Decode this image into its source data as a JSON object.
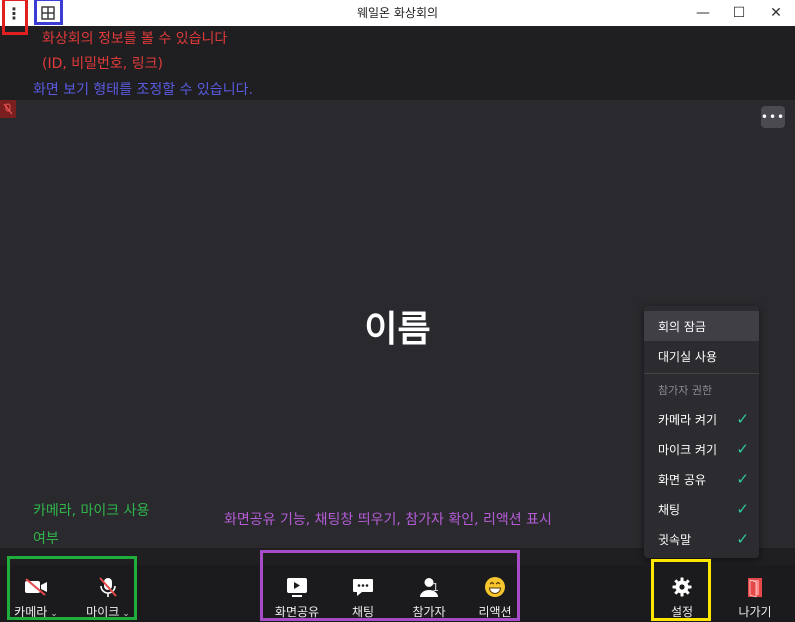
{
  "window": {
    "title": "웨일온 화상회의",
    "controls": {
      "minimize": "—",
      "maximize": "☐",
      "close": "✕"
    }
  },
  "annotations": {
    "info_line1": "화상회의 정보를 볼 수 있습니다",
    "info_line2": "(ID, 비밀번호, 링크)",
    "layout": "화면 보기 형태를 조정할 수 있습니다.",
    "av_line1": "카메라, 마이크 사용",
    "av_line2": "여부",
    "features": "화면공유 기능, 채팅창 띄우기, 참가자 확인, 리액션 표시"
  },
  "video": {
    "participant_name": "이름",
    "more_label": "•••"
  },
  "settings_menu": {
    "items": [
      "회의 잠금",
      "대기실 사용"
    ],
    "caption": "참가자 권한",
    "permissions": [
      {
        "label": "카메라 켜기",
        "checked": true
      },
      {
        "label": "마이크 켜기",
        "checked": true
      },
      {
        "label": "화면 공유",
        "checked": true
      },
      {
        "label": "채팅",
        "checked": true
      },
      {
        "label": "귓속말",
        "checked": true
      }
    ],
    "check_glyph": "✓"
  },
  "toolbar": {
    "camera": "카메라",
    "mic": "마이크",
    "screen_share": "화면공유",
    "chat": "채팅",
    "participants": "참가자",
    "participant_count": "1",
    "reactions": "리액션",
    "settings": "설정",
    "leave": "나가기",
    "caret": "⌄"
  },
  "colors": {
    "highlight_red": "#e02020",
    "highlight_blue": "#3b3bd6",
    "highlight_green": "#1fae3c",
    "highlight_purple": "#a64cc8",
    "highlight_yellow": "#ffe600",
    "annotation_red": "#e03a3a",
    "annotation_blue": "#5a5ae0",
    "annotation_green": "#2fb54a",
    "annotation_purple": "#b45cd6",
    "check": "#2fc9a3",
    "leave": "#e54848"
  }
}
